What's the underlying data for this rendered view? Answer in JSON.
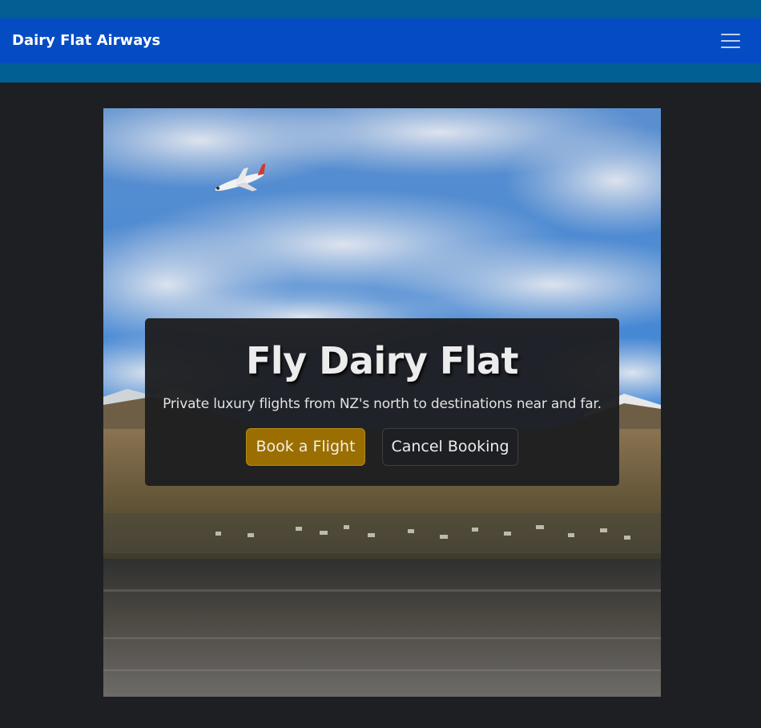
{
  "navbar": {
    "brand": "Dairy Flat Airways",
    "menu_icon": "hamburger-menu-icon"
  },
  "hero": {
    "image_description_icon": "airplane-over-lake-photo",
    "title": "Fly Dairy Flat",
    "subtitle": "Private luxury flights from NZ's north to destinations near and far.",
    "book_label": "Book a Flight",
    "cancel_label": "Cancel Booking"
  },
  "colors": {
    "page_background": "#1d1f22",
    "top_band": "#025e93",
    "navbar": "#054cc4",
    "book_button": "#9a6e00",
    "overlay": "#1e1e20"
  }
}
